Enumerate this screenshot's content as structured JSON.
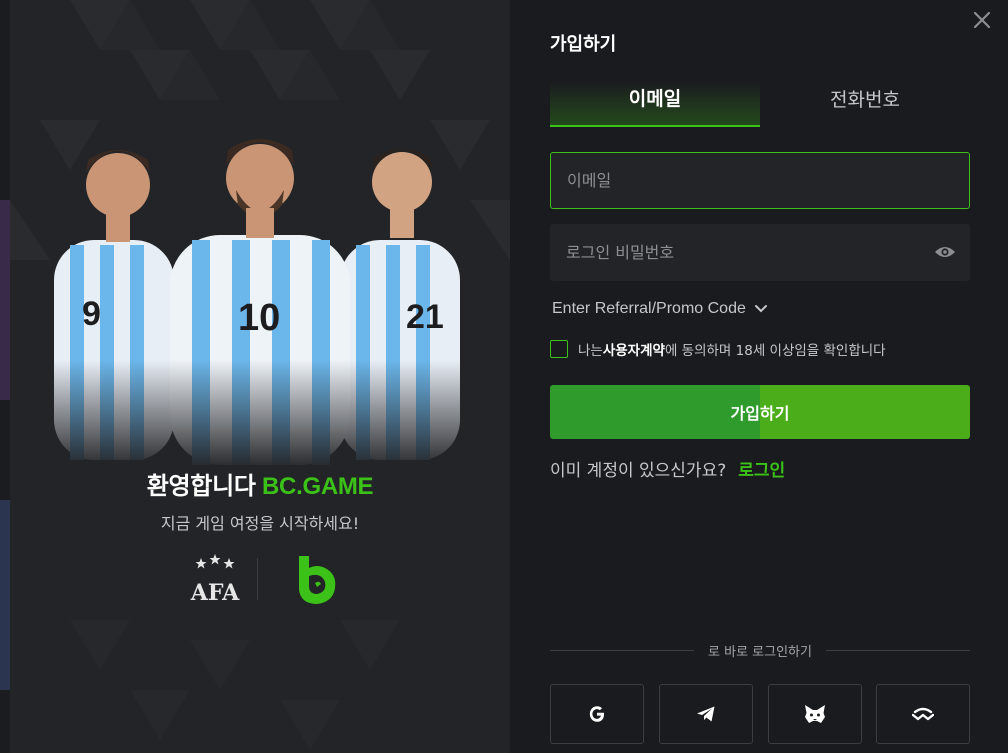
{
  "modal": {
    "title": "가입하기",
    "tabs": [
      {
        "label": "이메일",
        "active": true
      },
      {
        "label": "전화번호",
        "active": false
      }
    ],
    "email_placeholder": "이메일",
    "password_placeholder": "로그인 비밀번호",
    "referral_label": "Enter Referral/Promo Code",
    "agree": {
      "prefix": "나는 ",
      "terms": "사용자계약",
      "suffix": "에 동의하며 18세 이상임을 확인합니다"
    },
    "submit_label": "가입하기",
    "have_account": "이미 계정이 있으신가요?",
    "login_link": "로그인",
    "quick_login": "로 바로 로그인하기",
    "social": [
      {
        "icon": "google-icon"
      },
      {
        "icon": "telegram-icon"
      },
      {
        "icon": "metamask-icon"
      },
      {
        "icon": "walletconnect-icon"
      }
    ]
  },
  "promo": {
    "welcome": "환영합니다",
    "brand": "BC.GAME",
    "subtitle": "지금 게임 여정을 시작하세요!",
    "afa_text": "AFA",
    "jersey_numbers": [
      "9",
      "10",
      "21"
    ]
  },
  "colors": {
    "accent": "#3bc117",
    "modal_bg": "#1a1b1e",
    "panel_bg": "#232427",
    "field_bg": "#232427"
  }
}
